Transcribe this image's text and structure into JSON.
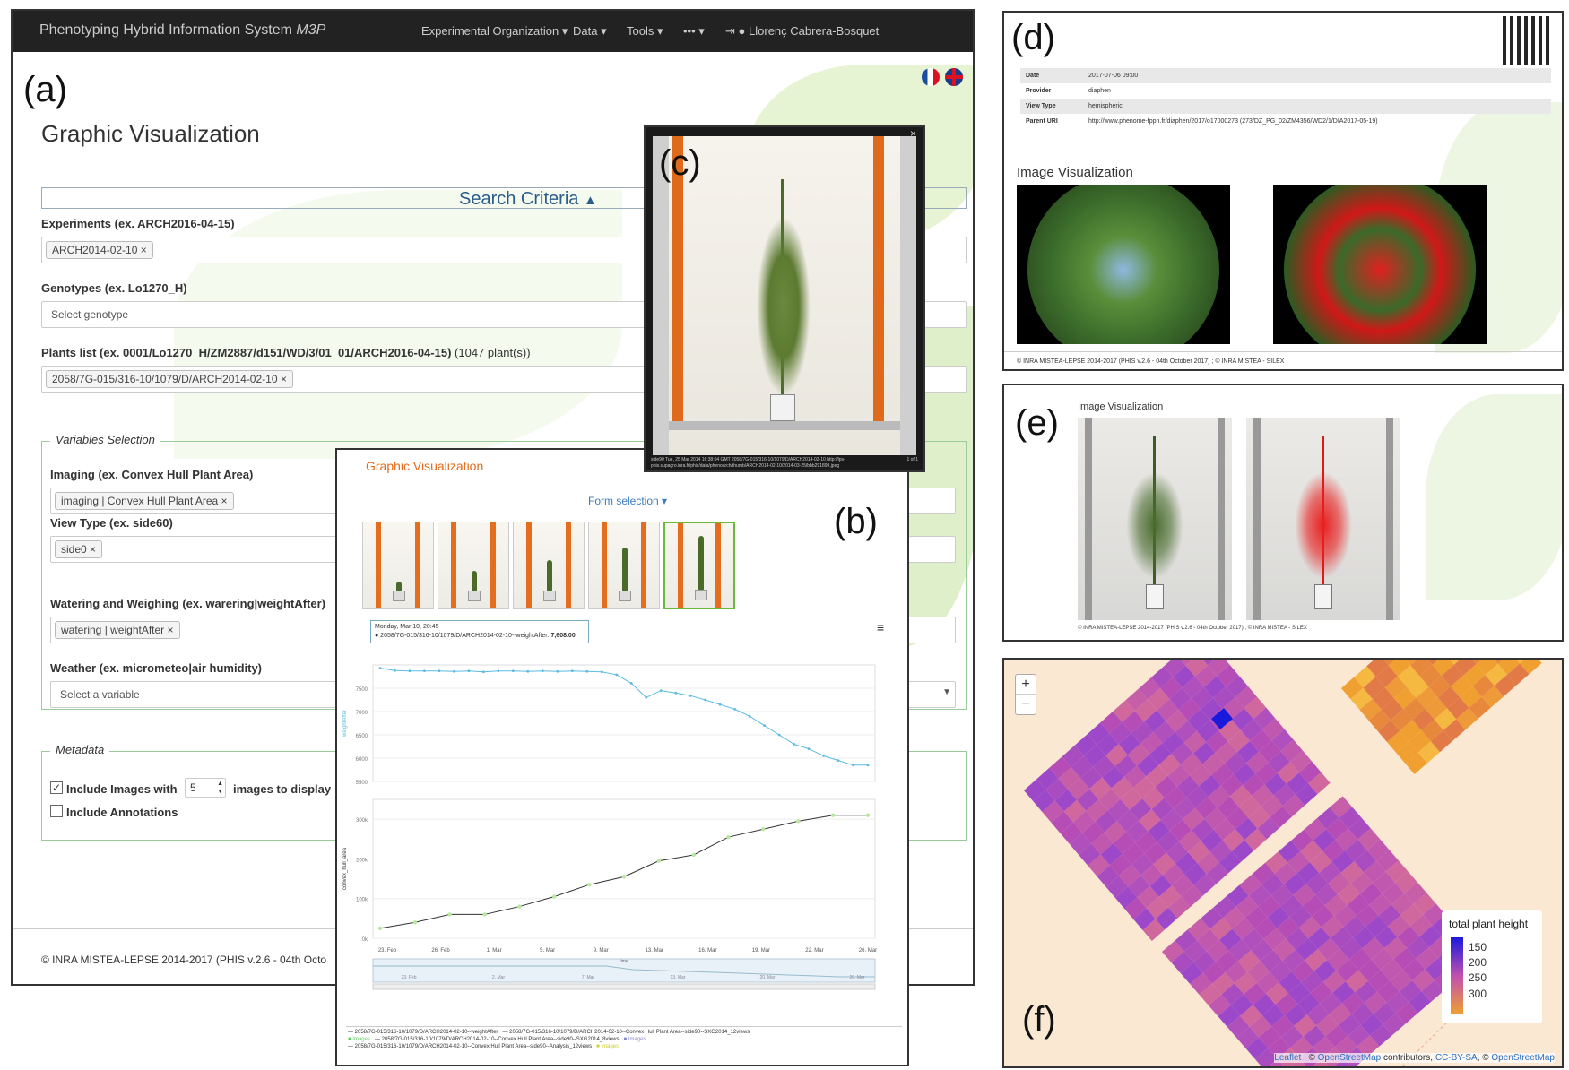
{
  "panel_letters": {
    "a": "(a)",
    "b": "(b)",
    "c": "(c)",
    "d": "(d)",
    "e": "(e)",
    "f": "(f)"
  },
  "panel_a": {
    "brand": "Phenotyping Hybrid Information System",
    "brand_em": "M3P",
    "nav": [
      "Experimental Organization ▾",
      "Data ▾",
      "Tools ▾",
      "••• ▾"
    ],
    "user": "Llorenç Cabrera-Bosquet",
    "title": "Graphic Visualization",
    "search_criteria": "Search Criteria",
    "experiments_label": "Experiments (ex. ARCH2016-04-15)",
    "experiments_tag": "ARCH2014-02-10 ×",
    "genotypes_label": "Genotypes (ex. Lo1270_H)",
    "genotypes_placeholder": "Select genotype",
    "plants_label": "Plants list (ex. 0001/Lo1270_H/ZM2887/d151/WD/3/01_01/ARCH2016-04-15)",
    "plants_count": "(1047 plant(s))",
    "plants_tag": "2058/7G-015/316-10/1079/D/ARCH2014-02-10 ×",
    "variables_legend": "Variables Selection",
    "imaging_label": "Imaging (ex. Convex Hull Plant Area)",
    "imaging_tag": "imaging | Convex Hull Plant Area ×",
    "viewtype_label": "View Type (ex. side60)",
    "viewtype_tag": "side0 ×",
    "watering_label": "Watering and Weighing (ex. warering|weightAfter)",
    "watering_tag": "watering | weightAfter ×",
    "weather_label": "Weather (ex. micrometeo|air humidity)",
    "weather_placeholder": "Select a variable",
    "metadata_legend": "Metadata",
    "include_images": "Include Images with",
    "images_count": "5",
    "images_suffix": "images to display",
    "include_annotations": "Include Annotations",
    "footer": "© INRA MISTEA-LEPSE 2014-2017 (PHIS v.2.6 - 04th Octo"
  },
  "panel_b": {
    "title": "Graphic Visualization",
    "form_selection": "Form selection ▾",
    "tooltip_date": "Monday, Mar 10, 20:45",
    "tooltip_series": "● 2058/7G-015/316-10/1079/D/ARCH2014-02-10--weightAfter:",
    "tooltip_value": "7,608.00",
    "menu_icon": "≡",
    "legend": [
      "— 2058/7G-015/316-10/1079/D/ARCH2014-02-10--weightAfter",
      "— 2058/7G-015/316-10/1079/D/ARCH2014-02-10--Convex Hull Plant Area--side90--SXG2014_12views",
      "■ Images",
      "— 2058/7G-015/316-10/1079/D/ARCH2014-02-10--Convex Hull Plant Area--side90--SXG2014_8views",
      "■ Images",
      "— 2058/7G-015/316-10/1079/D/ARCH2014-02-10--Convex Hull Plant Area--side90--Analysis_12views",
      "■ Images"
    ],
    "x_ticks": [
      "23. Feb",
      "26. Feb",
      "1. Mar",
      "5. Mar",
      "9. Mar",
      "13. Mar",
      "16. Mar",
      "19. Mar",
      "22. Mar",
      "26. Mar"
    ],
    "nav_ticks": [
      "23. Feb",
      "2. Mar",
      "7. Mar",
      "13. Mar",
      "20. Mar",
      "26. Mar"
    ],
    "nav_label": "time"
  },
  "chart_data": [
    {
      "type": "line",
      "title": "",
      "ylabel": "weightAfter",
      "ylim": [
        5500,
        8000
      ],
      "yticks": [
        "7500",
        "7000",
        "6500",
        "6000",
        "5500"
      ],
      "x": [
        "21. Feb",
        "22. Feb",
        "23. Feb",
        "24. Feb",
        "25. Feb",
        "26. Feb",
        "27. Feb",
        "28. Feb",
        "1. Mar",
        "2. Mar",
        "3. Mar",
        "4. Mar",
        "5. Mar",
        "6. Mar",
        "7. Mar",
        "8. Mar",
        "9. Mar",
        "10. Mar",
        "11. Mar",
        "12. Mar",
        "13. Mar",
        "14. Mar",
        "15. Mar",
        "16. Mar",
        "17. Mar",
        "18. Mar",
        "19. Mar",
        "20. Mar",
        "21. Mar",
        "22. Mar",
        "23. Mar",
        "24. Mar",
        "25. Mar",
        "26. Mar"
      ],
      "series": [
        {
          "name": "2058/7G-015/316-10/1079/D/ARCH2014-02-10--weightAfter",
          "color": "#5cbbe0",
          "values": [
            7930,
            7880,
            7870,
            7870,
            7870,
            7860,
            7870,
            7850,
            7870,
            7870,
            7860,
            7870,
            7860,
            7870,
            7860,
            7850,
            7790,
            7608,
            7300,
            7450,
            7400,
            7340,
            7250,
            7150,
            7050,
            6900,
            6700,
            6500,
            6300,
            6200,
            6050,
            5950,
            5850,
            5850
          ]
        }
      ]
    },
    {
      "type": "line",
      "title": "",
      "ylabel": "convex_hull_area",
      "ylim": [
        0,
        350000
      ],
      "yticks": [
        "300k",
        "200k",
        "100k",
        "0k"
      ],
      "x": [
        "22. Feb",
        "24. Feb",
        "27. Feb",
        "1. Mar",
        "3. Mar",
        "5. Mar",
        "8. Mar",
        "10. Mar",
        "12. Mar",
        "14. Mar",
        "17. Mar",
        "20. Mar",
        "22. Mar",
        "24. Mar",
        "26. Mar"
      ],
      "series": [
        {
          "name": "2058/7G-015/316-10/1079/D/ARCH2014-02-10--Convex Hull Plant Area--side90--SXG2014_12views",
          "color": "#333333",
          "values": [
            25000,
            40000,
            60000,
            60000,
            80000,
            105000,
            135000,
            155000,
            195000,
            210000,
            255000,
            275000,
            295000,
            310000,
            310000
          ]
        }
      ]
    }
  ],
  "panel_c": {
    "close": "×",
    "caption": "side90 Tue, 25 Mar 2014 16:38:04 GMT 2058/7G-015/316-10/1079/D/ARCH2014-02-10 http://lps-phis.supagro.inra.fr/phis/data/phenoarch/thumb/ARCH2014-02-10/2014-03-25/bbb291899.jpeg",
    "page": "1 of 1"
  },
  "panel_d": {
    "rows": [
      {
        "k": "Date",
        "v": "2017-07-06 09:00"
      },
      {
        "k": "Provider",
        "v": "diaphen"
      },
      {
        "k": "View Type",
        "v": "hemispheric"
      },
      {
        "k": "Parent URI",
        "v": "http://www.phenome-fppn.fr/diaphen/2017/o17000273 (273/DZ_PG_02/ZM4356/WD2/1/DIA2017-05-19)"
      }
    ],
    "image_title": "Image Visualization",
    "footer": "© INRA MISTEA-LEPSE 2014-2017 (PHIS v.2.6 - 04th October 2017) ; © INRA MISTEA - SILEX"
  },
  "panel_e": {
    "image_title": "Image Visualization",
    "footer": "© INRA MISTEA-LEPSE 2014-2017 (PHIS v.2.6 - 04th October 2017) ; © INRA MISTEA - SILEX"
  },
  "panel_f": {
    "zoom_in": "+",
    "zoom_out": "−",
    "legend_title": "total plant height",
    "legend_ticks": [
      "150",
      "200",
      "250",
      "300"
    ],
    "attribution_leaflet": "Leaflet",
    "attribution_mid": " | © ",
    "attribution_osm": "OpenStreetMap",
    "attribution_contrib": " contributors, ",
    "attribution_cc": "CC-BY-SA",
    "attribution_end": ", © ",
    "attribution_osm2": "OpenStreetMap",
    "colors": {
      "low": "#1a1adc",
      "mid": "#c050b0",
      "high": "#f0a030",
      "base_map": "#fae8d2"
    }
  }
}
